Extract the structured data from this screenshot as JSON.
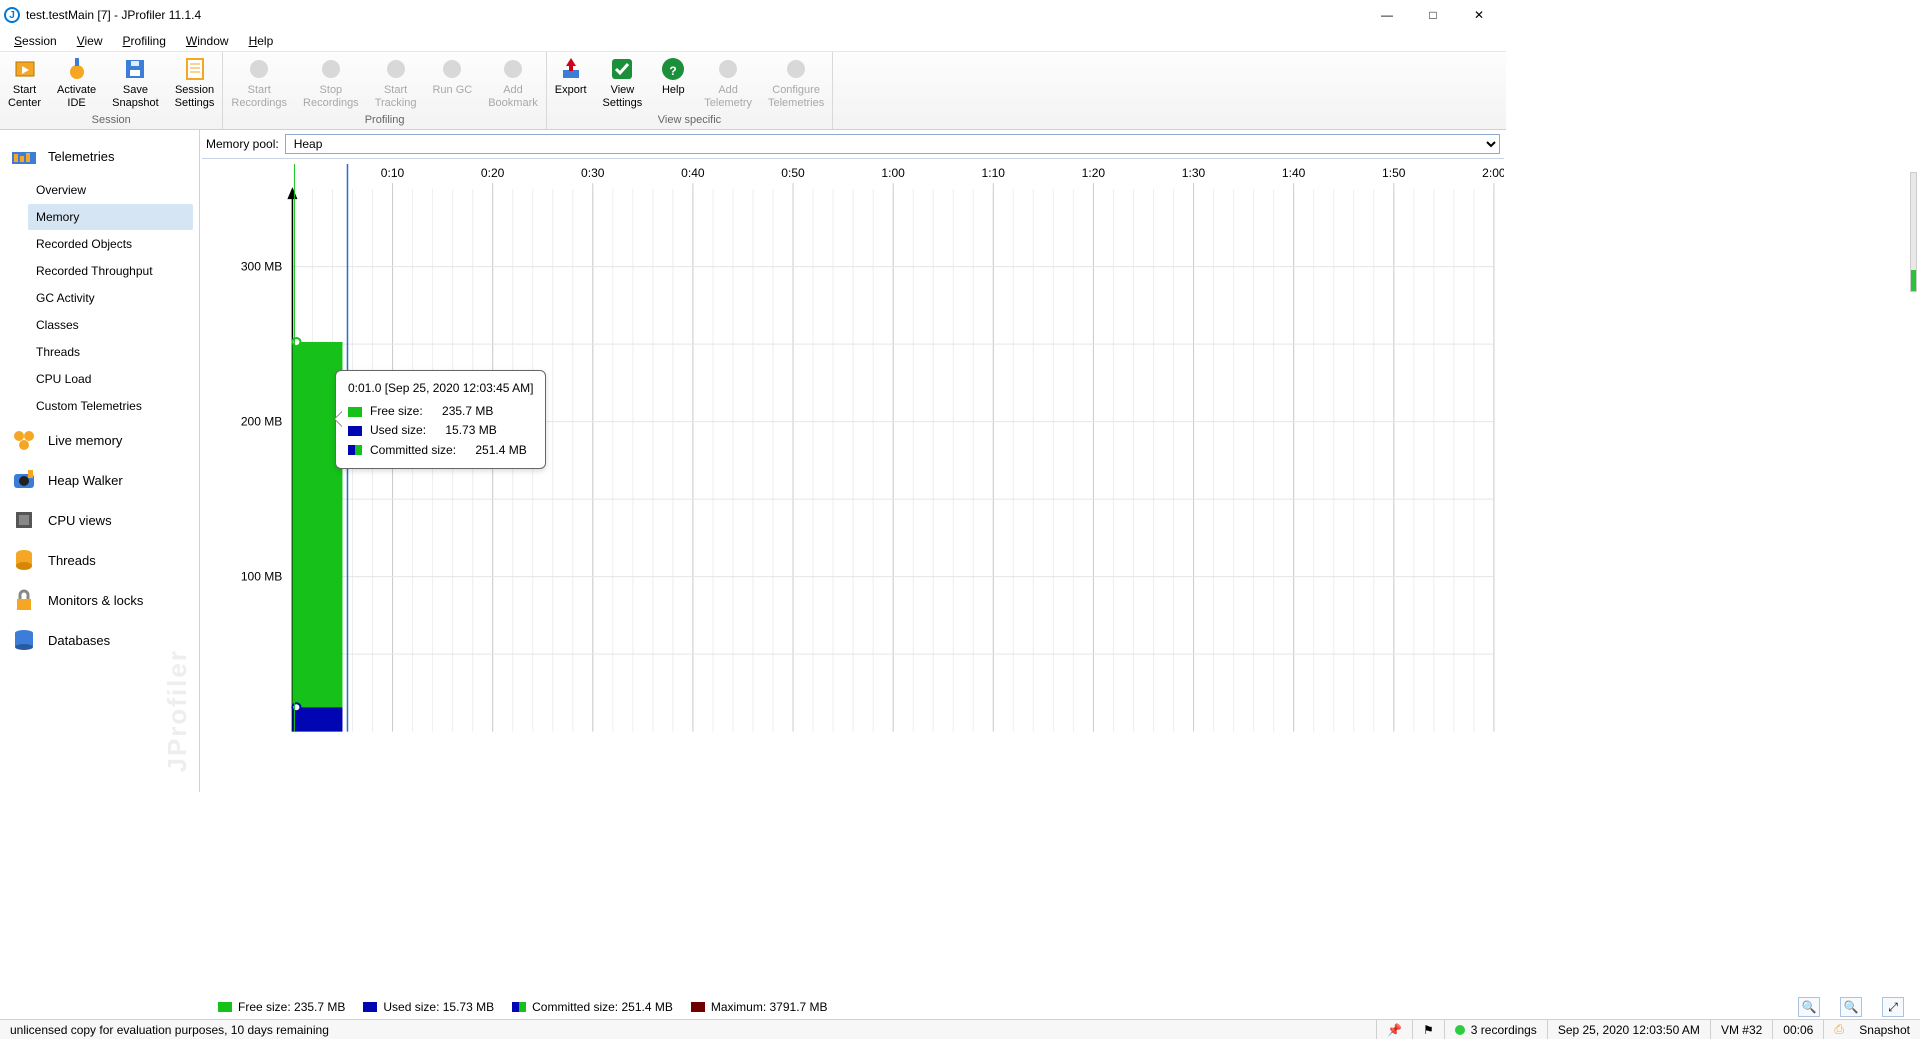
{
  "window": {
    "title": "test.testMain [7] - JProfiler 11.1.4"
  },
  "menus": [
    "Session",
    "View",
    "Profiling",
    "Window",
    "Help"
  ],
  "toolbar": {
    "groups": [
      {
        "label": "Session",
        "buttons": [
          {
            "key": "start-center",
            "label": "Start\nCenter",
            "color": "#f5a623",
            "enabled": true
          },
          {
            "key": "activate-ide",
            "label": "Activate\nIDE",
            "color": "#f5a623",
            "enabled": true
          },
          {
            "key": "save-snapshot",
            "label": "Save\nSnapshot",
            "color": "#3b7dd8",
            "enabled": true
          },
          {
            "key": "session-settings",
            "label": "Session\nSettings",
            "color": "#f5a623",
            "enabled": true
          }
        ]
      },
      {
        "label": "Profiling",
        "buttons": [
          {
            "key": "start-recordings",
            "label": "Start\nRecordings",
            "enabled": false
          },
          {
            "key": "stop-recordings",
            "label": "Stop\nRecordings",
            "enabled": false
          },
          {
            "key": "start-tracking",
            "label": "Start\nTracking",
            "enabled": false
          },
          {
            "key": "run-gc",
            "label": "Run GC",
            "enabled": false
          },
          {
            "key": "add-bookmark",
            "label": "Add\nBookmark",
            "enabled": false
          }
        ]
      },
      {
        "label": "View specific",
        "buttons": [
          {
            "key": "export",
            "label": "Export",
            "color": "#d0021b",
            "enabled": true
          },
          {
            "key": "view-settings",
            "label": "View\nSettings",
            "color": "#1c8f3a",
            "enabled": true
          },
          {
            "key": "help",
            "label": "Help",
            "color": "#1c8f3a",
            "enabled": true
          },
          {
            "key": "add-telemetry",
            "label": "Add\nTelemetry",
            "enabled": false
          },
          {
            "key": "configure-telemetries",
            "label": "Configure\nTelemetries",
            "enabled": false
          }
        ]
      }
    ]
  },
  "sidebar": {
    "sections": [
      {
        "key": "telemetries",
        "label": "Telemetries",
        "items": [
          {
            "key": "overview",
            "label": "Overview"
          },
          {
            "key": "memory",
            "label": "Memory",
            "selected": true
          },
          {
            "key": "recorded-objects",
            "label": "Recorded Objects"
          },
          {
            "key": "recorded-throughput",
            "label": "Recorded Throughput"
          },
          {
            "key": "gc-activity",
            "label": "GC Activity"
          },
          {
            "key": "classes",
            "label": "Classes"
          },
          {
            "key": "threads",
            "label": "Threads"
          },
          {
            "key": "cpu-load",
            "label": "CPU Load"
          },
          {
            "key": "custom-telemetries",
            "label": "Custom Telemetries"
          }
        ]
      },
      {
        "key": "live-memory",
        "label": "Live memory"
      },
      {
        "key": "heap-walker",
        "label": "Heap Walker"
      },
      {
        "key": "cpu-views",
        "label": "CPU views"
      },
      {
        "key": "sb-threads",
        "label": "Threads"
      },
      {
        "key": "monitors-locks",
        "label": "Monitors & locks"
      },
      {
        "key": "databases",
        "label": "Databases"
      }
    ],
    "watermark": "JProfiler"
  },
  "pool": {
    "label": "Memory pool:",
    "value": "Heap"
  },
  "chart_data": {
    "type": "area",
    "xlabel": "",
    "ylabel": "",
    "x_ticks": [
      "0:10",
      "0:20",
      "0:30",
      "0:40",
      "0:50",
      "1:00",
      "1:10",
      "1:20",
      "1:30",
      "1:40",
      "1:50",
      "2:00"
    ],
    "y_ticks": [
      "100 MB",
      "200 MB",
      "300 MB"
    ],
    "ylim": [
      0,
      350
    ],
    "cursor_x": "0:01.0",
    "series": [
      {
        "name": "Used size",
        "color": "#0006b1",
        "values_mb": [
          15.73
        ]
      },
      {
        "name": "Free size",
        "color": "#16c21a",
        "values_mb": [
          235.7
        ]
      },
      {
        "name": "Committed size",
        "color_left": "#0006b1",
        "color_right": "#16c21a",
        "values_mb": [
          251.4
        ]
      },
      {
        "name": "Maximum",
        "color": "#6f0000",
        "values_mb": [
          3791.7
        ]
      }
    ]
  },
  "tooltip": {
    "header": "0:01.0 [Sep 25, 2020 12:03:45 AM]",
    "rows": [
      {
        "color": "#16c21a",
        "label": "Free size:",
        "value": "235.7 MB"
      },
      {
        "color": "#0006b1",
        "label": "Used size:",
        "value": "15.73 MB"
      },
      {
        "color_left": "#0006b1",
        "color_right": "#16c21a",
        "label": "Committed size:",
        "value": "251.4 MB"
      }
    ]
  },
  "legend": {
    "items": [
      {
        "color": "#16c21a",
        "text": "Free size: 235.7 MB"
      },
      {
        "color": "#0006b1",
        "text": "Used size: 15.73 MB"
      },
      {
        "color_left": "#0006b1",
        "color_right": "#16c21a",
        "text": "Committed size: 251.4 MB"
      },
      {
        "color": "#6f0000",
        "text": "Maximum: 3791.7 MB"
      }
    ]
  },
  "status": {
    "license": "unlicensed copy for evaluation purposes, 10 days remaining",
    "recordings": "3 recordings",
    "timestamp": "Sep 25, 2020 12:03:50 AM",
    "vm": "VM #32",
    "elapsed": "00:06",
    "snapshot": "Snapshot"
  }
}
